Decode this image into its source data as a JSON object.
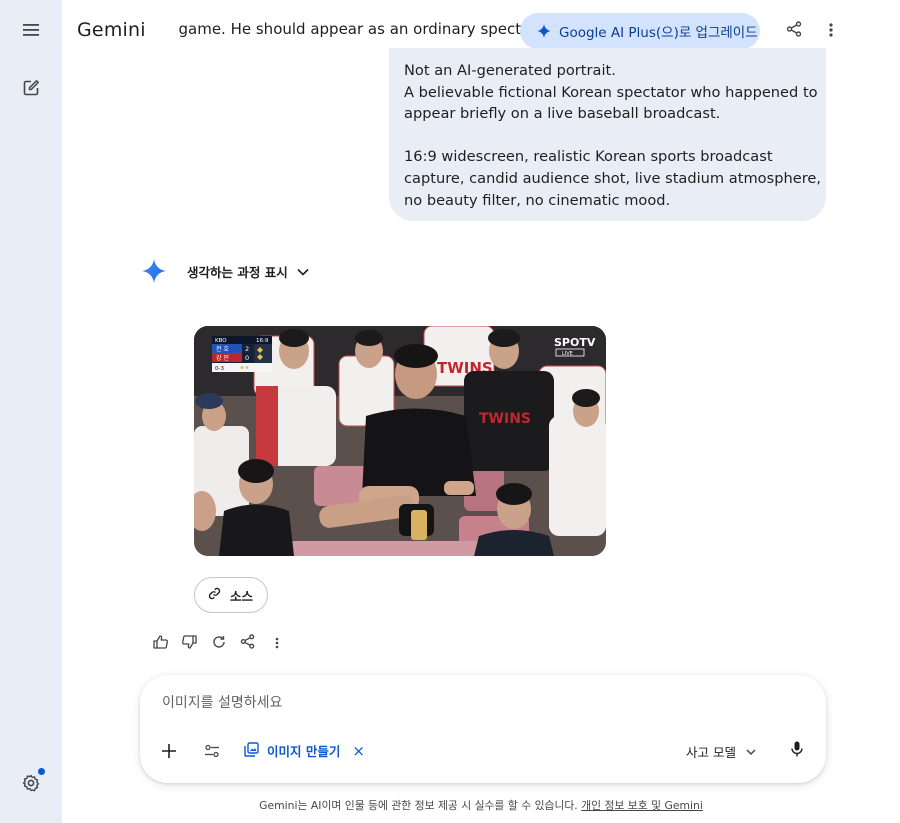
{
  "app": {
    "brand": "Gemini",
    "conversation_title": "he game. He should appear as an ordinary spectato",
    "upgrade_label": "Google AI Plus(으)로 업그레이드"
  },
  "sidebar": {
    "items": [
      {
        "icon": "menu-icon"
      },
      {
        "icon": "new-chat-icon"
      },
      {
        "icon": "settings-icon"
      }
    ]
  },
  "user_message": {
    "lines": [
      "Not an AI-generated portrait.",
      "A believable fictional Korean spectator who happened to",
      "appear briefly on a live baseball broadcast.",
      "",
      "16:9 widescreen, realistic Korean sports broadcast",
      "capture, candid audience shot, live stadium atmosphere,",
      "no beauty filter, no cinematic mood."
    ]
  },
  "response": {
    "thinking_label": "생각하는 과정 표시",
    "image_overlay": {
      "score_league": "KBO",
      "score_inning": "16:9",
      "team_top": "전 호",
      "score_top": "2",
      "team_bottom": "강 민",
      "score_bottom": "0",
      "count_text": "0-3",
      "broadcaster": "SPOTV",
      "broadcaster_sub": "LIVE",
      "jersey_text": "TWINS"
    },
    "source_label": "소스",
    "actions": [
      "thumbs-up-icon",
      "thumbs-down-icon",
      "regenerate-icon",
      "share-icon",
      "more-icon"
    ]
  },
  "prompt": {
    "placeholder": "이미지를 설명하세요",
    "tool_chip_label": "이미지 만들기",
    "tool_chip_close": "×",
    "mode_label": "사고 모델"
  },
  "footer": {
    "disclaimer": "Gemini는 AI이며 인물 등에 관한 정보 제공 시 실수를 할 수 있습니다.",
    "privacy_link": "개인 정보 보호 및 Gemini"
  },
  "colors": {
    "accent": "#0b57d0",
    "sidebar_bg": "#e9eef6",
    "bubble_bg": "#e9eef6",
    "upgrade_bg": "#d3e3fd"
  }
}
